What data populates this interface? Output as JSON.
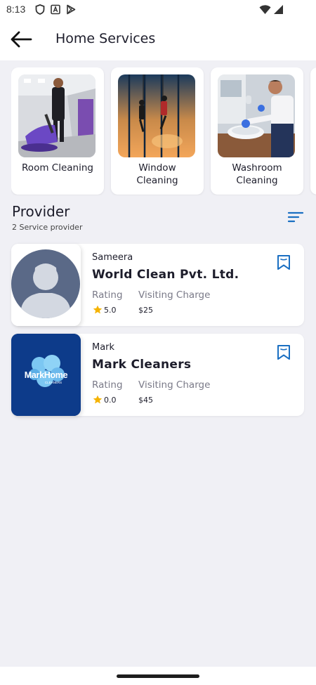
{
  "status_bar": {
    "time": "8:13",
    "icons_left": [
      "shield-icon",
      "font-icon",
      "play-store-icon"
    ],
    "icons_right": [
      "wifi-icon",
      "signal-icon"
    ]
  },
  "app_bar": {
    "title": "Home Services",
    "back_icon": "arrow-back-icon"
  },
  "categories": [
    {
      "label": "Room Cleaning",
      "image": "room-cleaning-photo"
    },
    {
      "label": "Window Cleaning",
      "image": "window-cleaning-photo"
    },
    {
      "label": "Washroom Cleaning",
      "image": "washroom-cleaning-photo"
    }
  ],
  "provider_section": {
    "title": "Provider",
    "subtitle": "2 Service provider",
    "filter_icon": "sort-icon"
  },
  "providers": [
    {
      "owner": "Sameera",
      "name": "World Clean Pvt. Ltd.",
      "rating_label": "Rating",
      "charge_label": "Visiting Charge",
      "rating": "5.0",
      "charge": "$25",
      "image": "avatar-placeholder"
    },
    {
      "owner": "Mark",
      "name": "Mark Cleaners",
      "rating_label": "Rating",
      "charge_label": "Visiting Charge",
      "rating": "0.0",
      "charge": "$45",
      "image": "markhome-logo",
      "logo_text": "MarkHome",
      "logo_subtext": "CLEANERS"
    }
  ],
  "colors": {
    "accent": "#1a6fc2",
    "star": "#f5b301",
    "background": "#f0f0f5",
    "card": "#ffffff",
    "text_primary": "#1d1d2b",
    "text_secondary": "#7a7a88",
    "logo_bg": "#0d3b8a"
  }
}
